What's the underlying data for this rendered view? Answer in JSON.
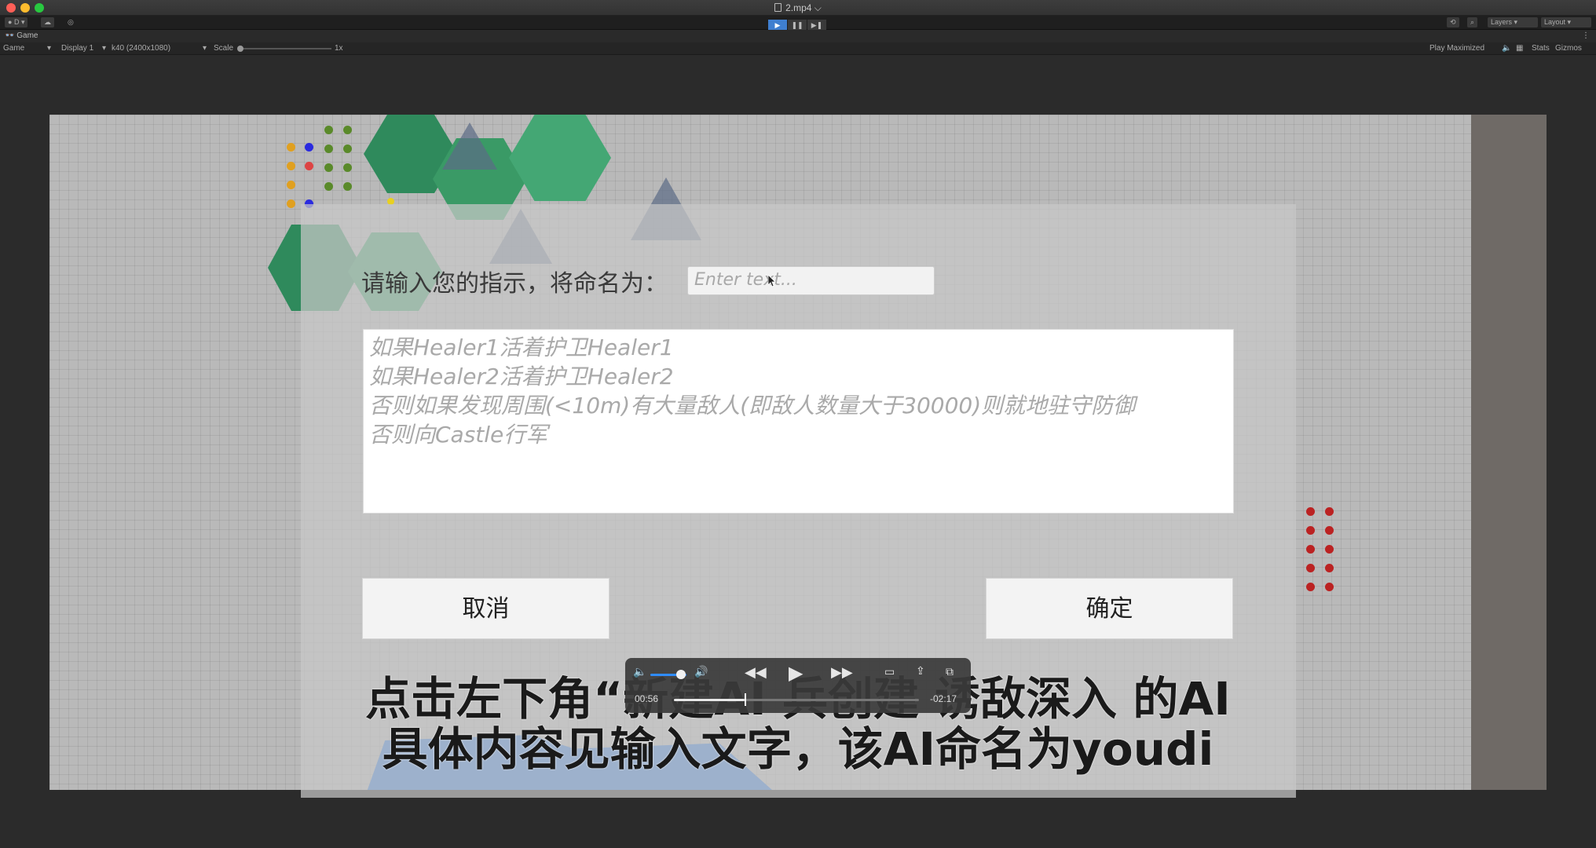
{
  "window": {
    "title": "2.mp4 ⌵"
  },
  "toolbar": {
    "account": "D",
    "layers": "Layers",
    "layout": "Layout"
  },
  "game_tab": {
    "label": "Game"
  },
  "game_toolbar": {
    "view": "Game",
    "display": "Display 1",
    "resolution": "k40 (2400x1080)",
    "scale_label": "Scale",
    "scale_value": "1x",
    "play_mode": "Play Maximized",
    "stats": "Stats",
    "gizmos": "Gizmos"
  },
  "dialog": {
    "prompt": "请输入您的指示，将命名为：",
    "name_placeholder": "Enter text...",
    "instruction_lines": [
      "如果Healer1活着护卫Healer1",
      "如果Healer2活着护卫Healer2",
      "否则如果发现周围(<10m)有大量敌人(即敌人数量大于30000)则就地驻守防御",
      "否则向Castle行军"
    ],
    "cancel": "取消",
    "confirm": "确定"
  },
  "subtitles": {
    "line1": "点击左下角“新建AI                    兵创建 诱敌深入 的AI",
    "line2": "具体内容见输入文字，该AI命名为youdi"
  },
  "player": {
    "elapsed": "00:56",
    "remaining": "-02:17",
    "progress": 0.29,
    "volume": 0.85
  },
  "colors": {
    "accent": "#2f8cff",
    "green_hex": "#4caf7d",
    "blue_ground": "#2f78d6"
  }
}
